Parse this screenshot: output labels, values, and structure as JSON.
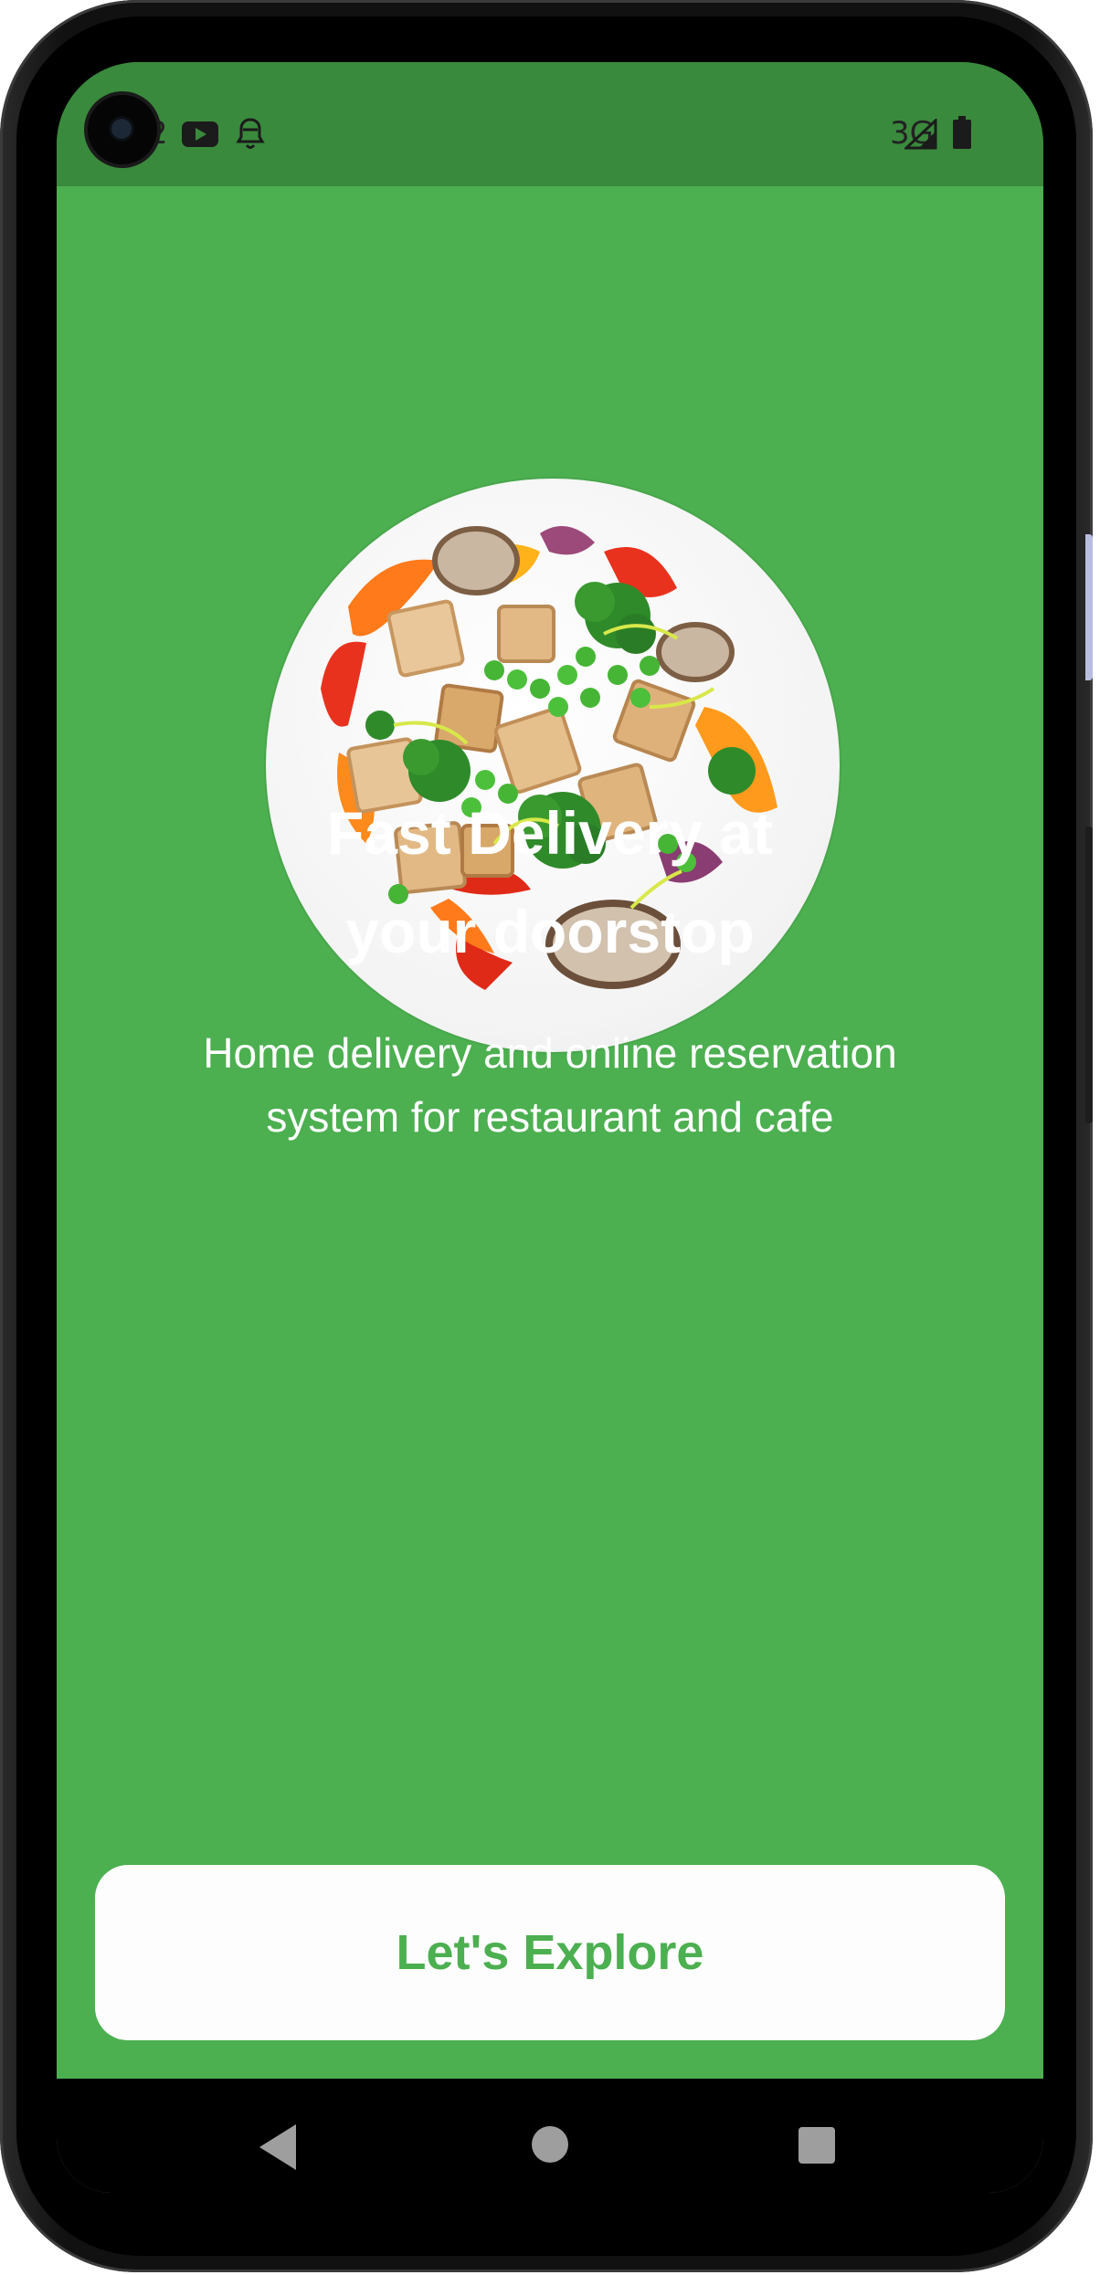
{
  "status_bar": {
    "clock_fragment": "2",
    "network": "3G",
    "icons": [
      "youtube-icon",
      "notification-icon",
      "signal-icon",
      "battery-icon"
    ]
  },
  "hero": {
    "image": "food-plate-icon",
    "title_line1": "Fast Delivery at",
    "title_line2": "your doorstop",
    "subtitle_line1": "Home delivery and online reservation",
    "subtitle_line2": "system for restaurant and cafe"
  },
  "cta": {
    "label": "Let's Explore"
  },
  "nav": {
    "icons": [
      "back-icon",
      "home-icon",
      "recents-icon"
    ]
  },
  "colors": {
    "brand_green": "#4caf50",
    "status_bar_green": "#3a8a3d",
    "button_bg": "#fdfdfd"
  }
}
